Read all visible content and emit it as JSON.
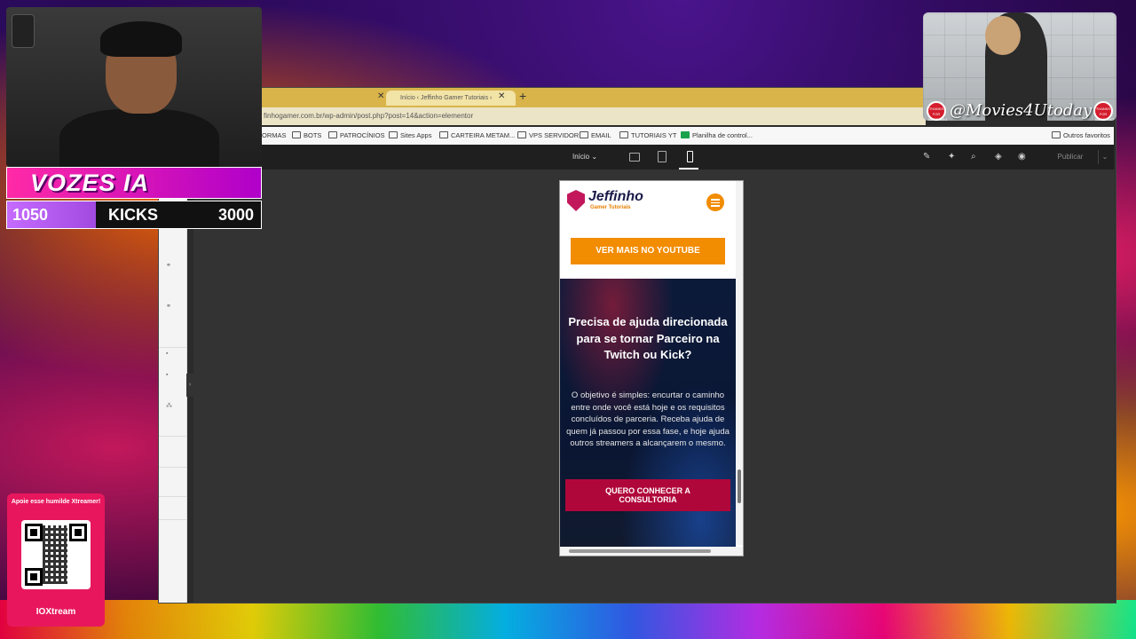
{
  "browser": {
    "tab_title": "Início ‹ Jeffinho Gamer Tutoriais ‹",
    "url": "finhogamer.com.br/wp-admin/post.php?post=14&action=elementor",
    "bookmarks": [
      "ORMAS",
      "BOTS",
      "PATROCÍNIOS",
      "Sites Apps",
      "CARTEIRA METAM...",
      "VPS SERVIDOR",
      "EMAIL",
      "TUTORIAIS YT",
      "Planilha de control..."
    ],
    "other_bookmarks": "Outros favoritos"
  },
  "elementor": {
    "page_selector": "Início",
    "publish_label": "Publicar",
    "device_mode": "mobile"
  },
  "site": {
    "logo_title": "Jeffinho",
    "logo_subtitle": "Gamer Tutoriais",
    "youtube_button": "VER MAIS NO YOUTUBE",
    "hero_title": "Precisa de ajuda direcionada para se tornar Parceiro na Twitch ou Kick?",
    "hero_text": "O objetivo é simples: encurtar o caminho entre onde você está hoje e os requisitos concluídos de parceria. Receba ajuda de quem já passou por essa fase, e hoje ajuda outros streamers a alcançarem o mesmo.",
    "cta_button": "QUERO CONHECER A CONSULTORIA"
  },
  "overlay": {
    "banner": "VOZES IA",
    "kicks_current": "1050",
    "kicks_label": "KICKS",
    "kicks_goal": "3000",
    "kicks_progress": 0.35,
    "qr_title": "Apoie esse humilde Xtreamer!",
    "qr_brand": "IOXtream",
    "movie_handle": "@Movies4Utoday",
    "badge_text": "THANKS FOR WATCHING"
  },
  "colors": {
    "accent_orange": "#f28c00",
    "cta_red": "#b0073a",
    "overlay_pink": "#e8175d"
  }
}
